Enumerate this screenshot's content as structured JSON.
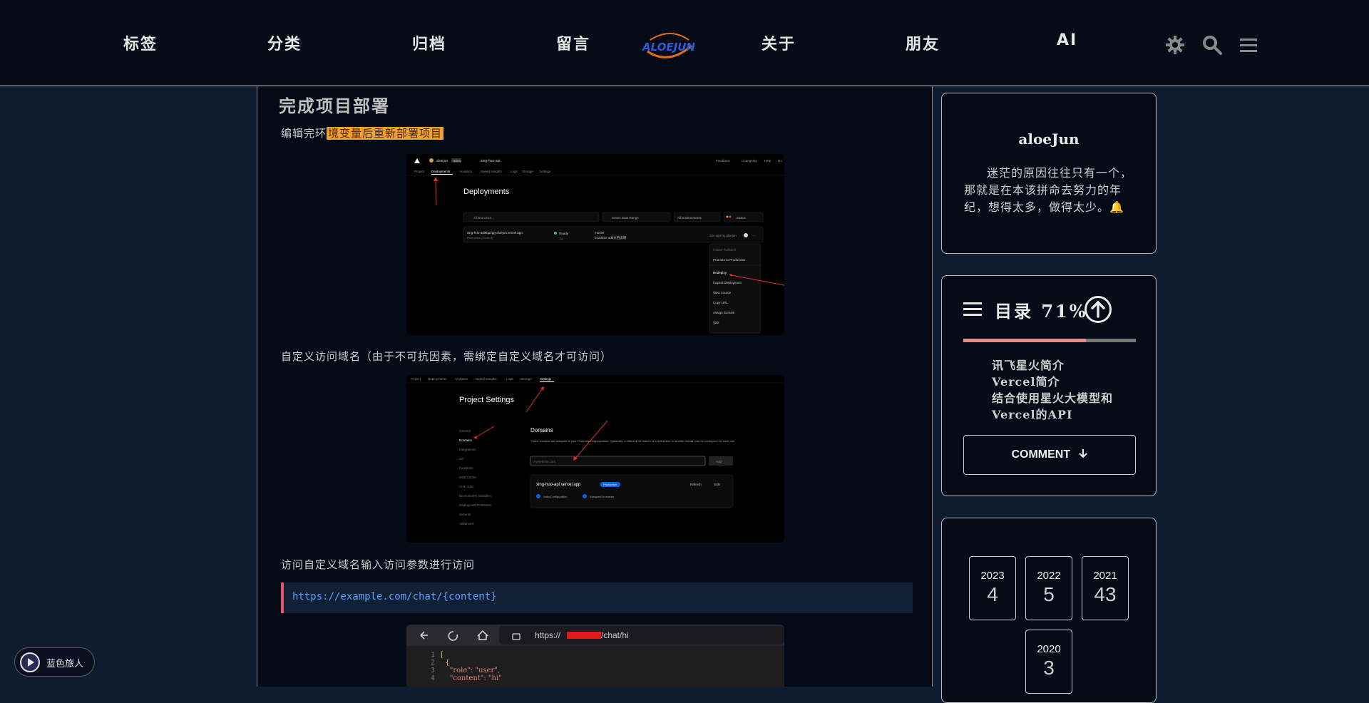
{
  "nav": {
    "items": [
      "标签",
      "分类",
      "归档",
      "留言",
      "关于",
      "朋友",
      "AI"
    ],
    "logo_text": "ALOEJUN"
  },
  "article": {
    "heading": "完成项目部署",
    "p1_text": "编辑完环",
    "p1_highlight": "境变量后重新部署项目",
    "p2": "自定义访问域名（由于不可抗因素，需绑定自定义域名才可访问）",
    "p3": "访问自定义域名输入访问参数进行访问",
    "code": "https://example.com/chat/{content}"
  },
  "shot1": {
    "user": "aloejun",
    "plan": "Hobby",
    "project": "xing-huo-api",
    "top_links": [
      "Feedback",
      "Changelog",
      "Help",
      "Do"
    ],
    "tabs": [
      "Project",
      "Deployments",
      "Analytics",
      "Speed Insights",
      "Logs",
      "Storage",
      "Settings"
    ],
    "title": "Deployments",
    "filter_branches": "All Branches...",
    "filter_date": "Select Date Range",
    "filter_env": "All Environments",
    "filter_status": "Status",
    "deploy_url": "xing-huo-adl9bp2gg-aloejun.vercel.app",
    "deploy_env": "Production (Current)",
    "deploy_status": "Ready",
    "deploy_time": "11s",
    "deploy_branch": "master",
    "deploy_commit": "b723b1e add文档说明",
    "deploy_ago": "10s ago by aloejun",
    "menu": [
      "Instant Rollback",
      "Promote to Production",
      "Redeploy",
      "Inspect Deployment",
      "View Source",
      "Copy URL",
      "Assign Domain",
      "Visit"
    ]
  },
  "shot2": {
    "tabs": [
      "Project",
      "Deployments",
      "Analytics",
      "Speed Insights",
      "Logs",
      "Storage",
      "Settings"
    ],
    "title": "Project Settings",
    "side": [
      "General",
      "Domains",
      "Integrations",
      "Git",
      "Functions",
      "Data Cache",
      "Cron Jobs",
      "Environment Variables",
      "Deployment Protection",
      "Security",
      "Advanced"
    ],
    "domains_title": "Domains",
    "domains_desc": "These domains are assigned to your Production Deployments. Optionally, a different Git branch or a redirection to another domain can be configured for each one.",
    "input_placeholder": "mywebsite.com",
    "add_btn": "Add",
    "domain": "xing-huo-api.vercel.app",
    "domain_badge": "Production",
    "refresh_btn": "Refresh",
    "edit_btn": "Edit",
    "check1": "Valid Configuration",
    "check2": "Assigned to master"
  },
  "shot3": {
    "url_prefix": "https://",
    "url_suffix": "/chat/hi",
    "code_lines": [
      "[",
      "  {",
      "    \"role\": \"user\",",
      "    \"content\": \"hi\""
    ]
  },
  "sidebar": {
    "author": "aloeJun",
    "motto": "迷茫的原因往往只有一个，那就是在本该拼命去努力的年纪，想得太多，做得太少。🔔",
    "toc_title": "目录",
    "toc_percent": "71%",
    "toc_progress": 0.71,
    "toc_items": [
      "讯飞星火简介",
      "Vercel简介",
      "结合使用星火大模型和",
      "Vercel的API"
    ],
    "comment_label": "COMMENT",
    "archives": [
      {
        "year": "2023",
        "count": "4"
      },
      {
        "year": "2022",
        "count": "5"
      },
      {
        "year": "2021",
        "count": "43"
      },
      {
        "year": "2020",
        "count": "3"
      }
    ]
  },
  "music": {
    "label": "蓝色旅人"
  },
  "colors": {
    "accent": "#e05a6a",
    "highlight": "#f0a030",
    "link": "#5aa0ff"
  }
}
